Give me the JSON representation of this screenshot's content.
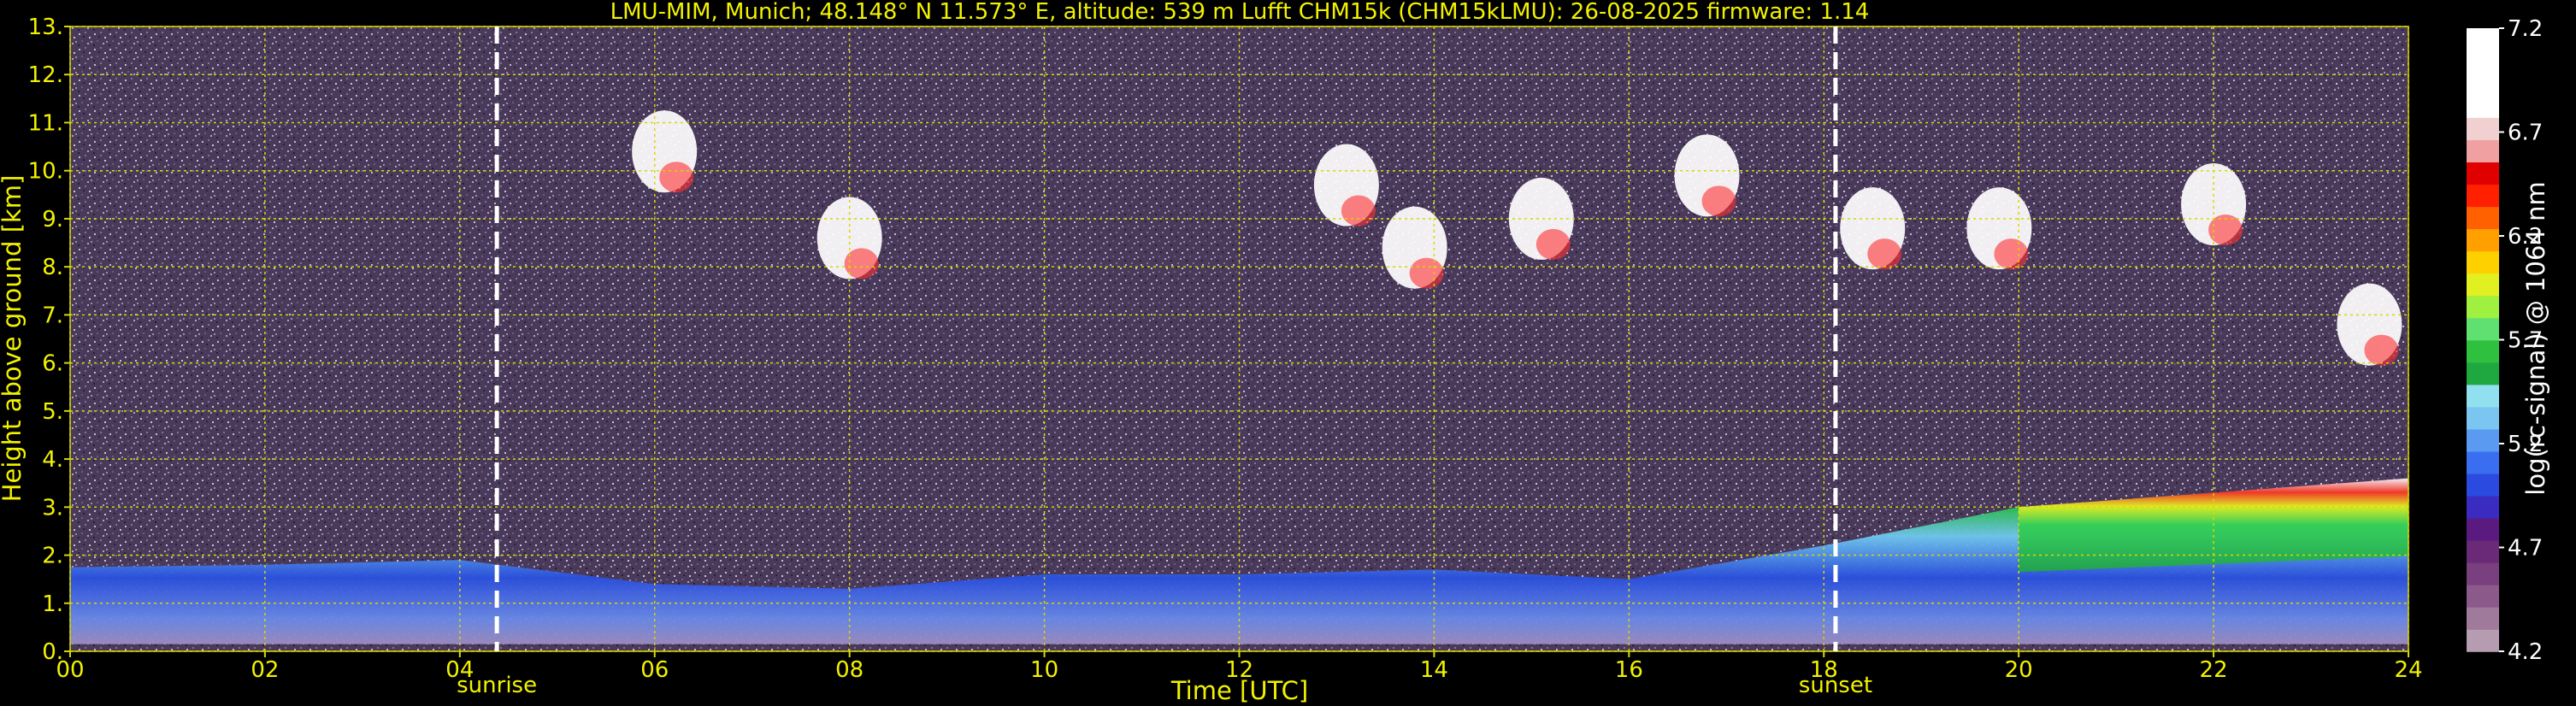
{
  "chart_data": {
    "type": "heatmap",
    "title": "LMU-MIM, Munich; 48.148° N 11.573° E, altitude: 539 m    Lufft CHM15k (CHM15kLMU): 26-08-2025    firmware: 1.14",
    "xlabel": "Time [UTC]",
    "ylabel": "Height above ground [km]",
    "xlim": [
      0,
      24
    ],
    "ylim": [
      0,
      13
    ],
    "x_ticks": [
      0,
      2,
      4,
      6,
      8,
      10,
      12,
      14,
      16,
      18,
      20,
      22,
      24
    ],
    "x_tick_labels": [
      "00",
      "02",
      "04",
      "06",
      "08",
      "10",
      "12",
      "14",
      "16",
      "18",
      "20",
      "22",
      "24"
    ],
    "y_ticks": [
      0,
      1,
      2,
      3,
      4,
      5,
      6,
      7,
      8,
      9,
      10,
      11,
      12,
      13
    ],
    "y_tick_labels": [
      "0.",
      "1.",
      "2.",
      "3.",
      "4.",
      "5.",
      "6.",
      "7.",
      "8.",
      "9.",
      "10.",
      "11.",
      "12.",
      "13."
    ],
    "grid": true,
    "markers": [
      {
        "label": "sunrise",
        "x": 4.38
      },
      {
        "label": "sunset",
        "x": 18.12
      }
    ],
    "colorbar": {
      "label": "log(rc-signal) @ 1064 nm",
      "range": [
        4.2,
        7.2
      ],
      "ticks": [
        4.2,
        4.7,
        5.2,
        5.7,
        6.2,
        6.7,
        7.2
      ],
      "tick_labels": [
        "4.2",
        "4.7",
        "5.2",
        "5.7",
        "6.2",
        "6.7",
        "7.2"
      ],
      "colors": [
        "#b59cb0",
        "#a07a9a",
        "#8c5a8a",
        "#7a3f7e",
        "#6a2a78",
        "#5a1a80",
        "#3a2cc0",
        "#2a4ae0",
        "#3a6ef0",
        "#5a9af0",
        "#7ac6f0",
        "#90e0f0",
        "#20a840",
        "#30c040",
        "#60e070",
        "#a0f040",
        "#e0f020",
        "#ffd000",
        "#ffa000",
        "#ff6000",
        "#ff2000",
        "#e00000",
        "#f0a0a0",
        "#f0d0d0",
        "#ffffff",
        "#ffffff",
        "#ffffff",
        "#ffffff"
      ]
    },
    "layers": [
      {
        "name": "aerosol-boundary-layer",
        "band": [
          [
            0,
            0.15,
            1.75
          ],
          [
            2,
            0.15,
            1.8
          ],
          [
            4,
            0.15,
            1.9
          ],
          [
            6,
            0.15,
            1.4
          ],
          [
            8,
            0.15,
            1.3
          ],
          [
            10,
            0.15,
            1.6
          ],
          [
            12,
            0.15,
            1.6
          ],
          [
            14,
            0.15,
            1.7
          ],
          [
            16,
            0.15,
            1.5
          ],
          [
            18,
            0.15,
            2.2
          ],
          [
            20,
            0.15,
            3.0
          ],
          [
            22,
            0.15,
            3.3
          ],
          [
            24,
            0.15,
            3.6
          ]
        ]
      },
      {
        "name": "cloud",
        "points": [
          [
            6.1,
            10.4
          ],
          [
            8.0,
            8.6
          ],
          [
            13.1,
            9.7
          ],
          [
            13.8,
            8.4
          ],
          [
            15.1,
            9.0
          ],
          [
            16.8,
            9.9
          ],
          [
            18.5,
            8.8
          ],
          [
            19.8,
            8.8
          ],
          [
            22.0,
            9.3
          ],
          [
            23.6,
            6.8
          ]
        ]
      }
    ]
  }
}
